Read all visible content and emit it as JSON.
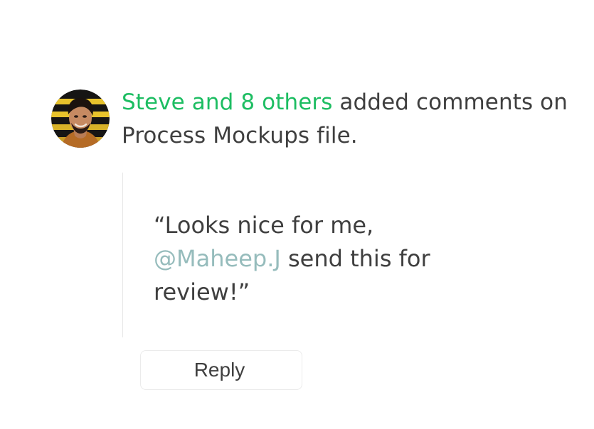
{
  "notification": {
    "actor_text": "Steve and 8 others",
    "message_text": " added comments on Process Mockups file.",
    "accent_color": "#1dbd62"
  },
  "comment": {
    "line_1": "“Looks nice for me,",
    "mention": "@Maheep.J",
    "line_2_rest": " send this for review!”",
    "mention_color": "#96bcbc"
  },
  "actions": {
    "reply_label": "Reply"
  }
}
